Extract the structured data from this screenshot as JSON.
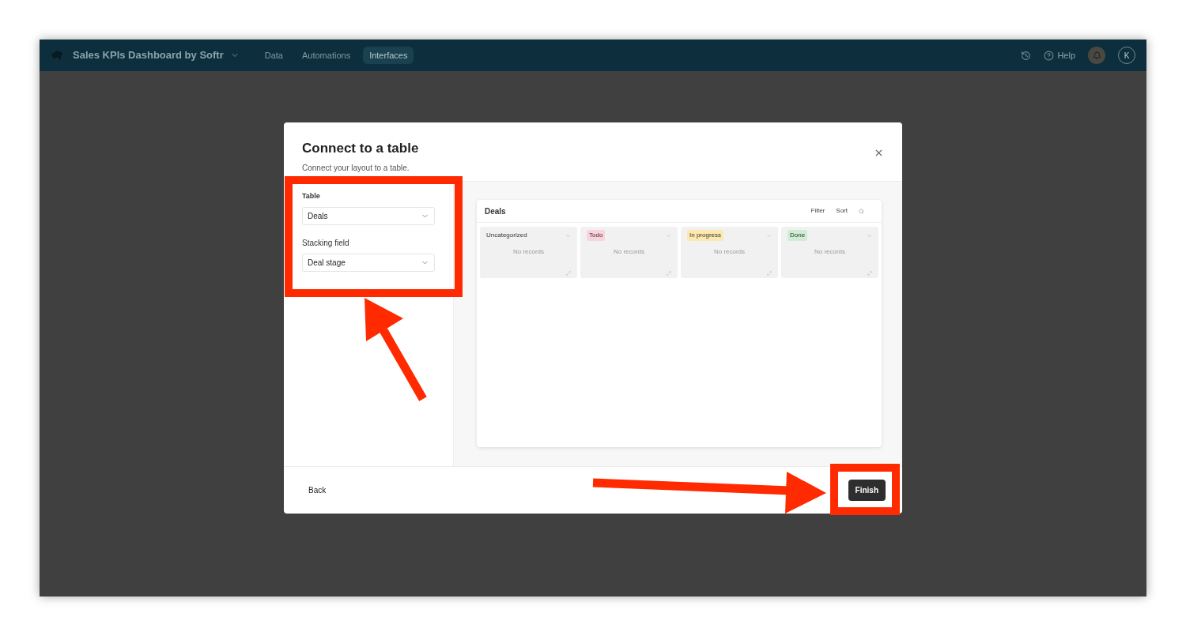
{
  "topbar": {
    "app_title": "Sales KPIs Dashboard by Softr",
    "nav": [
      {
        "label": "Data",
        "selected": false
      },
      {
        "label": "Automations",
        "selected": false
      },
      {
        "label": "Interfaces",
        "selected": true
      }
    ],
    "help": "Help",
    "avatar": "K"
  },
  "dialog": {
    "title": "Connect to a table",
    "subtitle": "Connect your layout to a table.",
    "fields": [
      {
        "label": "Table",
        "value": "Deals"
      },
      {
        "label": "Stacking field",
        "value": "Deal stage"
      }
    ],
    "preview": {
      "title": "Deals",
      "actions": [
        "Filter",
        "Sort"
      ],
      "columns": [
        {
          "kind": "plain",
          "label": "Uncategorized",
          "empty": "No records"
        },
        {
          "kind": "tag",
          "label": "Todo",
          "color": "#fbd3dc",
          "empty": "No records"
        },
        {
          "kind": "tag",
          "label": "In progress",
          "color": "#fde8b0",
          "empty": "No records"
        },
        {
          "kind": "tag",
          "label": "Done",
          "color": "#cdeed3",
          "empty": "No records"
        }
      ]
    },
    "back": "Back",
    "finish": "Finish"
  }
}
